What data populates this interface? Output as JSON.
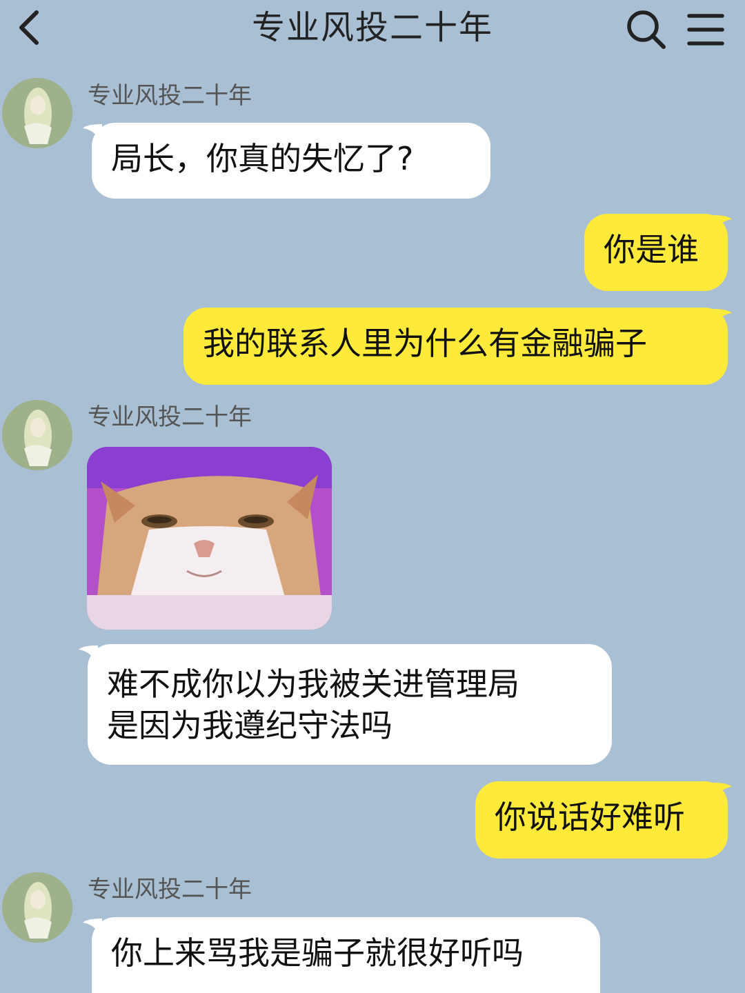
{
  "header": {
    "title": "专业风投二十年",
    "back_icon": "chevron-left-icon",
    "search_icon": "search-icon",
    "menu_icon": "menu-icon"
  },
  "messages": [
    {
      "sender": "专业风投二十年",
      "text": "局长，你真的失忆了?"
    },
    {
      "text": "你是谁"
    },
    {
      "text": "我的联系人里为什么有金融骗子"
    },
    {
      "sender": "专业风投二十年",
      "sticker": "cat-sticker"
    },
    {
      "text": "难不成你以为我被关进管理局\n是因为我遵纪守法吗"
    },
    {
      "text": "你说话好难听"
    },
    {
      "sender": "专业风投二十年",
      "text": "你上来骂我是骗子就很好听吗"
    }
  ],
  "colors": {
    "background": "#a9bfd3",
    "incoming_bubble": "#ffffff",
    "outgoing_bubble": "#fdea3a",
    "avatar_bg": "#9fb18a"
  }
}
